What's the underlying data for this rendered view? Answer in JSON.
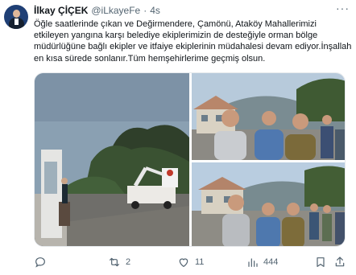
{
  "tweet": {
    "author_name": "İlkay ÇİÇEK",
    "handle": "@iLkayeFe",
    "separator": "·",
    "time": "4s",
    "more_label": "···",
    "text": "Öğle saatlerinde çıkan ve Değirmendere, Çamönü, Ataköy Mahallerimizi etkileyen yangına karşı belediye ekiplerimizin de desteğiyle orman bölge müdürlüğüne bağlı ekipler ve itfaiye ekiplerinin müdahalesi devam ediyor.İnşallah en kısa sürede sonlanır.Tüm hemşehirlerime geçmiş olsun."
  },
  "actions": {
    "reply_icon": "reply-icon",
    "retweet_count": "2",
    "like_count": "11",
    "views_count": "444"
  },
  "colors": {
    "text": "#0f1419",
    "secondary": "#536471",
    "avatar_bg": "#1f3f75"
  }
}
